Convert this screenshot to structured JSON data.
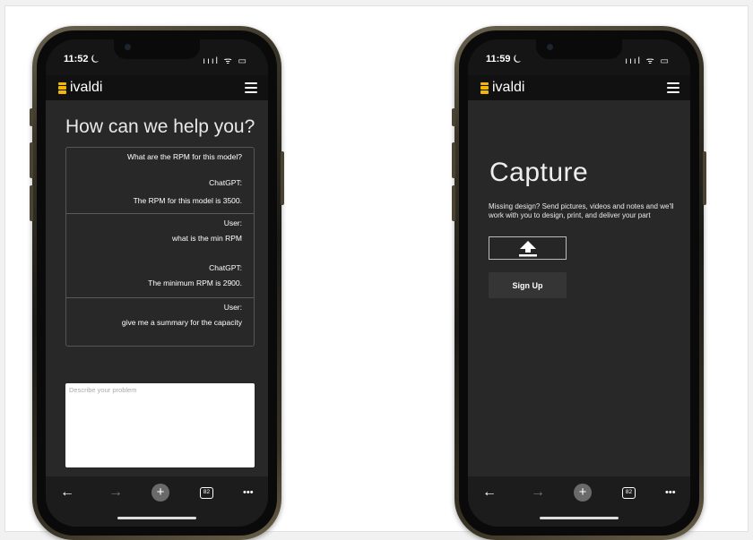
{
  "phone_left": {
    "status": {
      "time": "11:52 ⏾",
      "icons": "ıııl ᯤ ▭"
    },
    "appbar": {
      "brand": "ivaldi"
    },
    "page_title": "How can we help you?",
    "chat": [
      {
        "lines": [
          "What are the RPM for this model?",
          "ChatGPT:",
          "The RPM for this model is 3500."
        ]
      },
      {
        "lines": [
          "User:",
          "what is the min RPM",
          "ChatGPT:",
          "The minimum RPM is 2900."
        ]
      },
      {
        "lines": [
          "User:",
          "give me a summary for the capacity"
        ]
      }
    ],
    "description": {
      "placeholder": "Describe your problem",
      "value": ""
    },
    "nav": {
      "back": "←",
      "forward": "→",
      "new_tab": "+",
      "tab_count": "82",
      "more": "•••"
    }
  },
  "phone_right": {
    "status": {
      "time": "11:59 ⏾",
      "icons": "ıııl ᯤ ▭"
    },
    "appbar": {
      "brand": "ivaldi"
    },
    "page_title": "Capture",
    "description": "Missing design? Send pictures, videos and notes and we'll work with you to design, print, and deliver your part",
    "signup_label": "Sign Up",
    "nav": {
      "back": "←",
      "forward": "→",
      "new_tab": "+",
      "tab_count": "82",
      "more": "•••"
    }
  },
  "colors": {
    "screen_bg": "#282828",
    "brand_yellow": "#f2b705",
    "appbar_bg": "#111111"
  },
  "icons": [
    "moon-icon",
    "signal-icon",
    "wifi-icon",
    "battery-icon",
    "ivaldi-logo-icon",
    "hamburger-menu-icon",
    "upload-icon",
    "back-arrow-icon",
    "forward-arrow-icon",
    "plus-icon",
    "tab-count-icon",
    "more-icon"
  ]
}
